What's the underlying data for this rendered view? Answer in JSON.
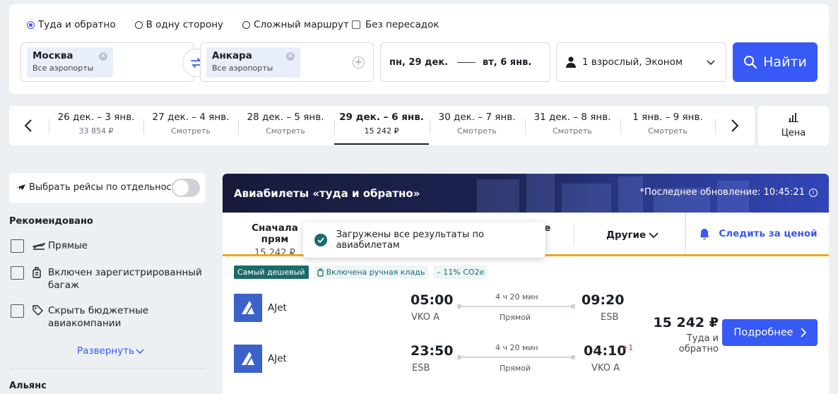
{
  "search": {
    "trip_types": [
      {
        "label": "Туда и обратно",
        "selected": true
      },
      {
        "label": "В одну сторону",
        "selected": false
      },
      {
        "label": "Сложный маршрут",
        "selected": false
      }
    ],
    "direct_only_label": "Без пересадок",
    "from": {
      "city": "Москва",
      "airports": "Все аэропорты"
    },
    "to": {
      "city": "Анкара",
      "airports": "Все аэропорты"
    },
    "depart_date": "пн, 29 дек.",
    "return_date": "вт, 6 янв.",
    "passengers": "1 взрослый, Эконом",
    "search_label": "Найти"
  },
  "date_strip": {
    "options": [
      {
        "range": "26 дек. – 3 янв.",
        "price": "33 854 ₽",
        "active": false
      },
      {
        "range": "27 дек. – 4 янв.",
        "price": "Смотреть",
        "active": false
      },
      {
        "range": "28 дек. – 5 янв.",
        "price": "Смотреть",
        "active": false
      },
      {
        "range": "29 дек. – 6 янв.",
        "price": "15 242 ₽",
        "active": true
      },
      {
        "range": "30 дек. – 7 янв.",
        "price": "Смотреть",
        "active": false
      },
      {
        "range": "31 дек. – 8 янв.",
        "price": "Смотреть",
        "active": false
      },
      {
        "range": "1 янв. – 9 янв.",
        "price": "Смотреть",
        "active": false
      }
    ],
    "price_chart_label": "Цена"
  },
  "sidebar": {
    "separate_flights_label": "Выбрать рейсы по отдельности",
    "recommended_heading": "Рекомендовано",
    "filters": [
      {
        "label": "Прямые",
        "icon": "plane-icon"
      },
      {
        "label": "Включен зарегистрированный\nбагаж",
        "icon": "luggage-icon"
      },
      {
        "label": "Скрыть бюджетные\nавиакомпании",
        "icon": "tag-icon"
      }
    ],
    "expand_label": "Развернуть",
    "alliance_heading": "Альянс"
  },
  "results": {
    "banner_title": "Авиабилеты «туда и обратно»",
    "last_update": "*Последнее обновление: 10:45:21",
    "sort_tabs": [
      {
        "title": "Сначала прям",
        "price": "15 242 ₽"
      },
      {
        "title": "ие",
        "price": ""
      }
    ],
    "other_label": "Другие",
    "track_price_label": "Следить за ценой",
    "toast": "Загружены все результаты по авиабилетам",
    "ticket": {
      "badge_cheapest": "Самый дешевый",
      "badge_baggage": "Включена ручная кладь",
      "badge_co2": "– 11% CO2e",
      "legs": [
        {
          "airline": "AJet",
          "dep_time": "05:00",
          "dep_airport": "VKO A",
          "duration": "4 ч 20 мин",
          "stops": "Прямой",
          "arr_time": "09:20",
          "arr_airport": "ESB",
          "plus_day": ""
        },
        {
          "airline": "AJet",
          "dep_time": "23:50",
          "dep_airport": "ESB",
          "duration": "4 ч 20 мин",
          "stops": "Прямой",
          "arr_time": "04:10",
          "arr_airport": "VKO A",
          "plus_day": "+1"
        }
      ],
      "price": "15 242 ₽",
      "price_type": "Туда и обратно",
      "details_label": "Подробнее"
    }
  }
}
